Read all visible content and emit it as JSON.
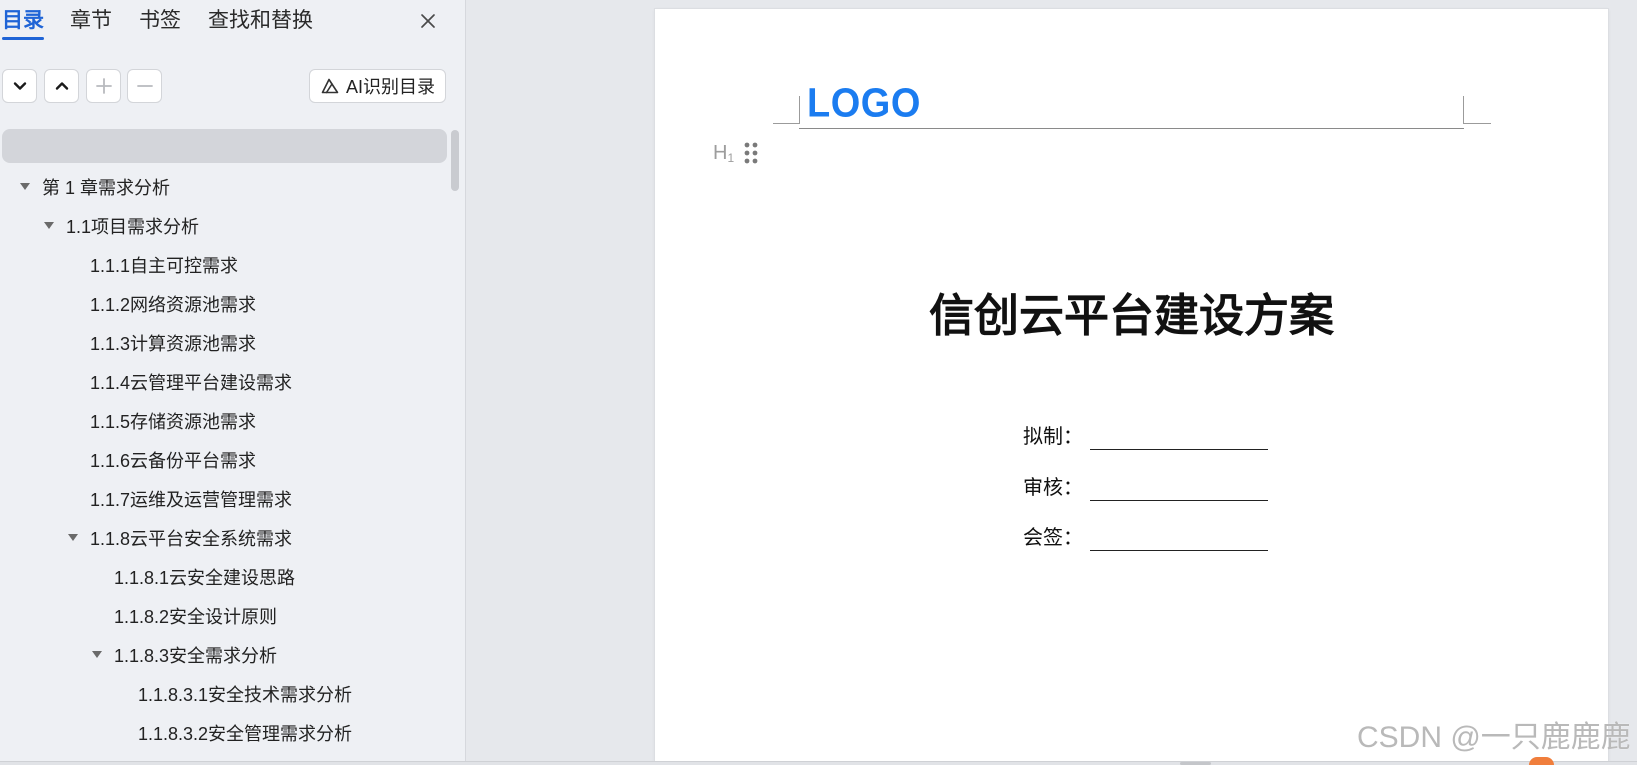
{
  "colors": {
    "accent": "#1f64d6",
    "logo": "#1b7cf0"
  },
  "sidebar": {
    "tabs": [
      {
        "label": "目录",
        "active": true
      },
      {
        "label": "章节",
        "active": false
      },
      {
        "label": "书签",
        "active": false
      },
      {
        "label": "查找和替换",
        "active": false
      }
    ],
    "close_icon": "close-icon",
    "toolbar": {
      "buttons": [
        {
          "icon": "chevron-down-icon",
          "enabled": true
        },
        {
          "icon": "chevron-up-icon",
          "enabled": true
        },
        {
          "icon": "plus-icon",
          "enabled": false
        },
        {
          "icon": "minus-icon",
          "enabled": false
        }
      ],
      "ai_button": {
        "icon": "ai-recognize-icon",
        "label": "AI识别目录"
      }
    },
    "outline": [
      {
        "label": "第 1 章需求分析",
        "level": 0,
        "expanded": true
      },
      {
        "label": "1.1项目需求分析",
        "level": 1,
        "expanded": true
      },
      {
        "label": "1.1.1自主可控需求",
        "level": 2,
        "expanded": false
      },
      {
        "label": "1.1.2网络资源池需求",
        "level": 2,
        "expanded": false
      },
      {
        "label": "1.1.3计算资源池需求",
        "level": 2,
        "expanded": false
      },
      {
        "label": "1.1.4云管理平台建设需求",
        "level": 2,
        "expanded": false
      },
      {
        "label": "1.1.5存储资源池需求",
        "level": 2,
        "expanded": false
      },
      {
        "label": "1.1.6云备份平台需求",
        "level": 2,
        "expanded": false
      },
      {
        "label": "1.1.7运维及运营管理需求",
        "level": 2,
        "expanded": false
      },
      {
        "label": "1.1.8云平台安全系统需求",
        "level": 2,
        "expanded": true
      },
      {
        "label": "1.1.8.1云安全建设思路",
        "level": 3,
        "expanded": false
      },
      {
        "label": "1.1.8.2安全设计原则",
        "level": 3,
        "expanded": false
      },
      {
        "label": "1.1.8.3安全需求分析",
        "level": 3,
        "expanded": true
      },
      {
        "label": "1.1.8.3.1安全技术需求分析",
        "level": 4,
        "expanded": false
      },
      {
        "label": "1.1.8.3.2安全管理需求分析",
        "level": 4,
        "expanded": false
      }
    ]
  },
  "document": {
    "header_logo": "LOGO",
    "heading_badge": {
      "letter": "H",
      "level": "1"
    },
    "drag_handle_icon": "drag-handle-icon",
    "title": "信创云平台建设方案",
    "signoff": [
      {
        "label": "拟制：",
        "value": ""
      },
      {
        "label": "审核：",
        "value": ""
      },
      {
        "label": "会签：",
        "value": ""
      }
    ]
  },
  "watermark": "CSDN @一只鹿鹿鹿"
}
